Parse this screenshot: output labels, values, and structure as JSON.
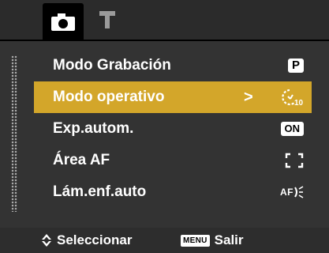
{
  "tabs": [
    {
      "icon": "camera-icon",
      "active": true
    },
    {
      "icon": "wrench-icon",
      "active": false
    }
  ],
  "menu": {
    "items": [
      {
        "label": "Modo Grabación",
        "value_icon": "program-mode-icon",
        "value_text": "P"
      },
      {
        "label": "Modo operativo",
        "value_icon": "self-timer-icon",
        "value_text": "",
        "selected": true,
        "submenu_arrow": ">"
      },
      {
        "label": "Exp.autom.",
        "value_icon": "on-badge",
        "value_text": "ON"
      },
      {
        "label": "Área AF",
        "value_icon": "af-area-brackets-icon",
        "value_text": ""
      },
      {
        "label": "Lám.enf.auto",
        "value_icon": "af-assist-lamp-icon",
        "value_text": "AF"
      }
    ]
  },
  "footer": {
    "select_icon": "up-down-arrows-icon",
    "select_label": "Seleccionar",
    "menu_key": "MENU",
    "exit_label": "Salir"
  },
  "colors": {
    "background": "#333333",
    "highlight": "#d3a62a",
    "text": "#ffffff"
  }
}
